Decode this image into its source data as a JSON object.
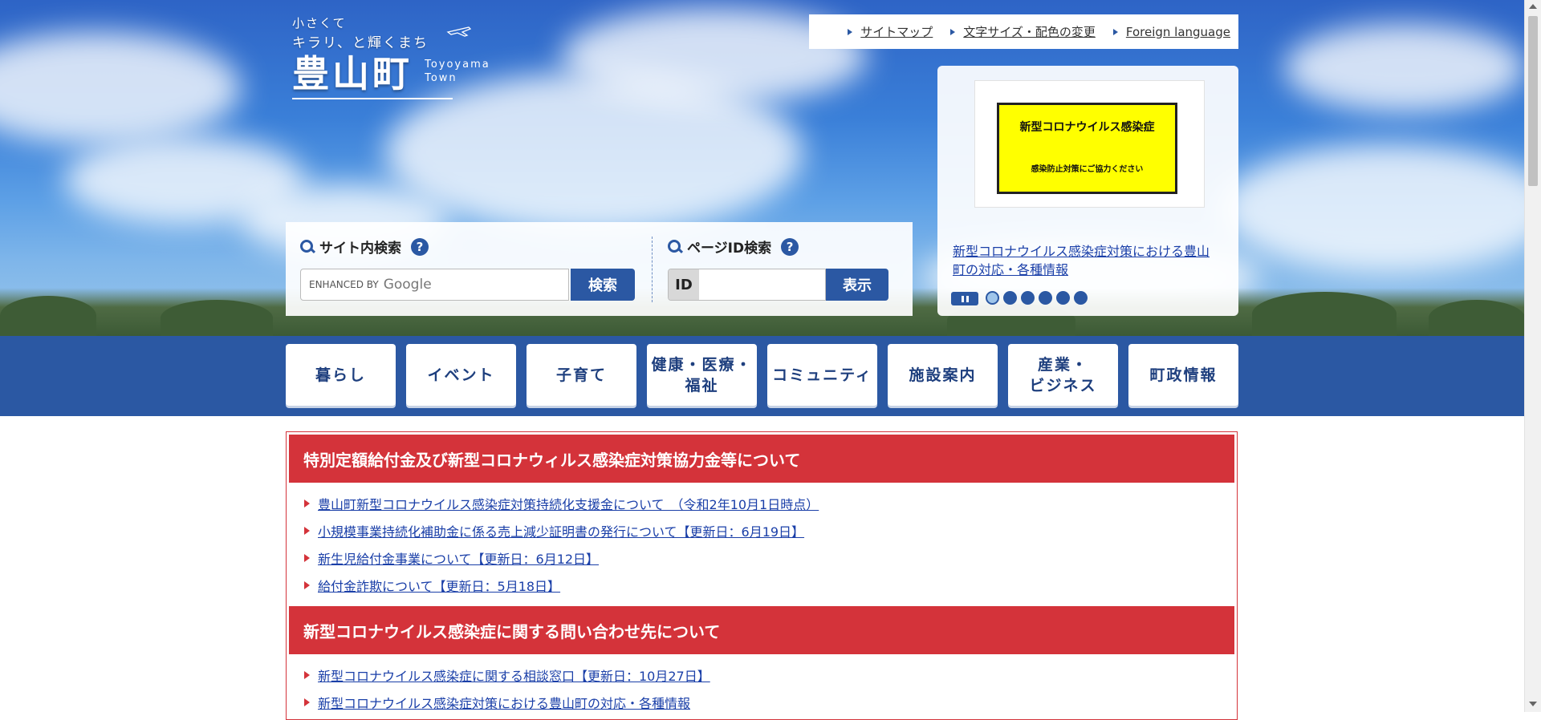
{
  "header": {
    "logo": {
      "tagline_line1": "小さくて",
      "tagline_line2": "キラリ、と輝くまち",
      "name": "豊山町",
      "roman_line1": "Toyoyama",
      "roman_line2": "Town"
    },
    "top_links": [
      {
        "label": "サイトマップ"
      },
      {
        "label": "文字サイズ・配色の変更"
      },
      {
        "label": "Foreign language"
      }
    ]
  },
  "site_search": {
    "title": "サイト内検索",
    "help_label": "?",
    "placeholder_prefix": "ENHANCED BY",
    "placeholder_brand": "Google",
    "button_label": "検索"
  },
  "page_id_search": {
    "title": "ページID検索",
    "help_label": "?",
    "id_label": "ID",
    "button_label": "表示"
  },
  "slideshow": {
    "slide_title": "新型コロナウイルス感染症",
    "slide_subtitle": "感染防止対策にご協力ください",
    "caption": "新型コロナウイルス感染症対策における豊山町の対応・各種情報",
    "dot_count": 6,
    "active_dot": 0
  },
  "global_nav": [
    {
      "label": "暮らし"
    },
    {
      "label": "イベント"
    },
    {
      "label": "子育て"
    },
    {
      "label": "健康・医療・\n福祉"
    },
    {
      "label": "コミュニティ"
    },
    {
      "label": "施設案内"
    },
    {
      "label": "産業・\nビジネス"
    },
    {
      "label": "町政情報"
    }
  ],
  "notice_sections": [
    {
      "heading": "特別定額給付金及び新型コロナウィルス感染症対策協力金等について",
      "links": [
        "豊山町新型コロナウイルス感染症対策持続化支援金について　（令和2年10月1日時点）",
        "小規模事業持続化補助金に係る売上減少証明書の発行について【更新日：6月19日】",
        "新生児給付金事業について【更新日：6月12日】",
        "給付金詐欺について【更新日：5月18日】"
      ]
    },
    {
      "heading": "新型コロナウイルス感染症に関する問い合わせ先について",
      "links": [
        "新型コロナウイルス感染症に関する相談窓口【更新日：10月27日】",
        "新型コロナウイルス感染症対策における豊山町の対応・各種情報"
      ]
    }
  ],
  "colors": {
    "brand_blue": "#2b58a3",
    "alert_red": "#d4333a",
    "slide_yellow": "#ffff00",
    "link_blue": "#1a3fa8"
  }
}
